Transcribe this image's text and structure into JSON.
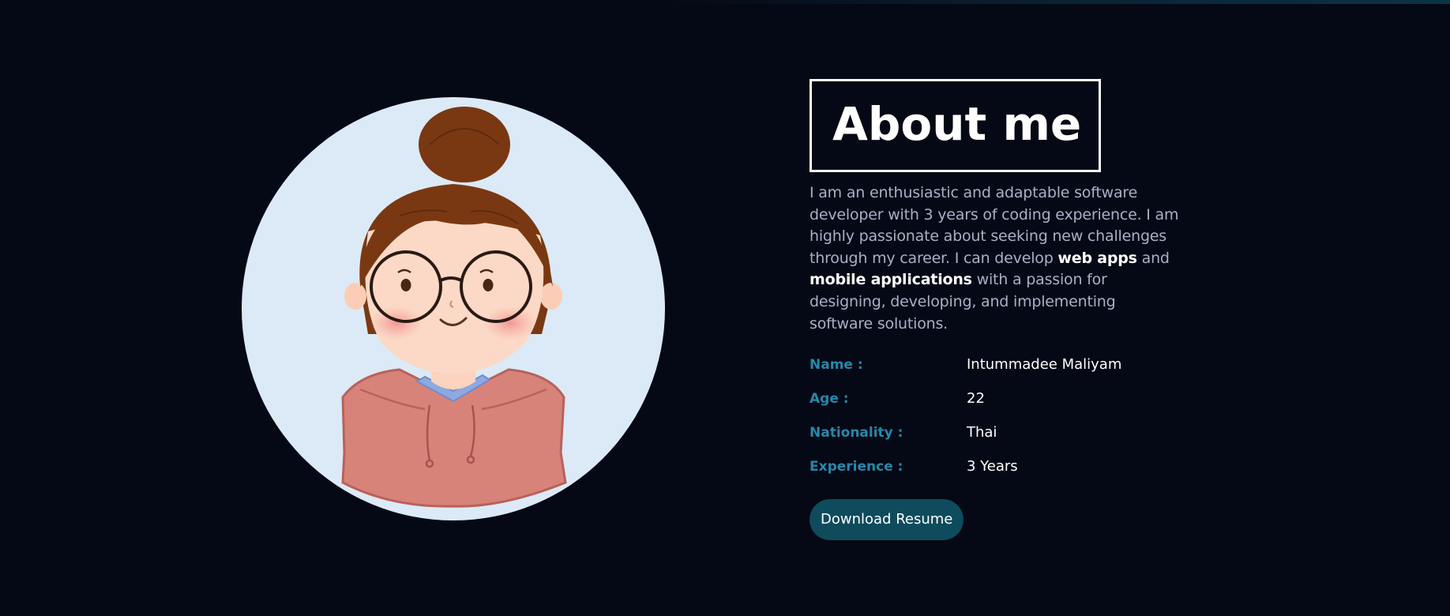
{
  "about": {
    "title": "About me",
    "bio": {
      "part1": "I am an enthusiastic and adaptable software developer with 3 years of coding experience. I am highly passionate about seeking new challenges through my career. I can develop ",
      "bold1": "web apps",
      "part2": " and ",
      "bold2": "mobile applications",
      "part3": " with a passion for designing, developing, and implementing software solutions."
    },
    "info": [
      {
        "label": "Name :",
        "value": "Intummadee Maliyam"
      },
      {
        "label": "Age :",
        "value": "22"
      },
      {
        "label": "Nationality :",
        "value": "Thai"
      },
      {
        "label": "Experience :",
        "value": "3 Years"
      }
    ],
    "download_label": "Download Resume"
  },
  "colors": {
    "background": "#050815",
    "accent_label": "#2389aa",
    "button_bg": "#0e4b5c",
    "avatar_circle": "#dbeaf6"
  },
  "icons": {
    "avatar": "cartoon-girl-avatar"
  }
}
